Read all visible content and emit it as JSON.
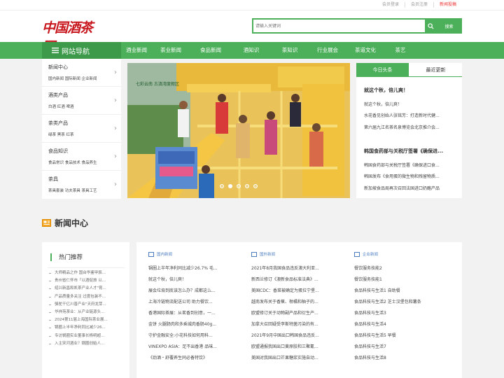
{
  "topbar": {
    "links": [
      "会员登录",
      "会员注册",
      "新闻投稿"
    ]
  },
  "logo": {
    "text": "中国酒茶网"
  },
  "search": {
    "placeholder": "请输入关键词",
    "button": "搜索"
  },
  "nav": {
    "title": "网站导航",
    "items": [
      "酒业新闻",
      "茶业新闻",
      "食品新闻",
      "酒知识",
      "茶知识",
      "行业展会",
      "茶道文化",
      "茶艺"
    ]
  },
  "sidebar": [
    {
      "title": "新闻中心",
      "sub": "国内新闻 国际新闻 企业新闻"
    },
    {
      "title": "酒类产品",
      "sub": "白酒 红酒 啤酒"
    },
    {
      "title": "茶类产品",
      "sub": "绿茶 黑茶 红茶"
    },
    {
      "title": "食品知识",
      "sub": "食品常识 食品技术 食品养生"
    },
    {
      "title": "茶具",
      "sub": "茶具套装 功夫茶具 茶具工艺"
    }
  ],
  "banner": {
    "caption": "七彩云南 古滇湾度假区"
  },
  "right_panel": {
    "tabs": [
      "今日头条",
      "最近更新"
    ],
    "headlines": [
      "就这个秋，倍儿爽！",
      "韩国食药部与关税厅签署《确保进..."
    ],
    "group1": [
      "就这个秋，倍儿爽！",
      "水花香见创始人张铭芳：打造新时代健...",
      "第六届九江名茶名泉博览会北京推介会..."
    ],
    "group2": [
      "韩国食药部与关税厅签署《确保进口食...",
      "韩国发布《食用蛋的微生物和残留物质...",
      "新加坡食品局再次召回法国进口奶酪产品"
    ]
  },
  "news_center": {
    "title": "新闻中心"
  },
  "hot": {
    "title": "热门推荐",
    "items": [
      "大师精品之作 国台华鉴甲辰...",
      "贵州省仁怀市「以酒促旅 以...",
      "绍兴新昌和凯茶产业人才\"育...",
      "产品质量多关注 过度包装不...",
      "骆驼干亿川普产业\"天府龙芽...",
      "华祥苑茶业：从产业链源头...",
      "2024第11届上海国际茶业展...",
      "锅圈上半年净利同比减少26...",
      "专访锅圈实业董事长杨明超...",
      "入主宋河酒业？锅圈创始人..."
    ]
  },
  "columns": [
    {
      "head": "国内新闻",
      "items": [
        "锅圈上半年净利同比减少26.7% 毛...",
        "就这个秋，倍儿爽！",
        "展会垃圾到底该怎么办？成都这么...",
        "上海冷链物流配送公司 助力餐饮...",
        "香港国际茶展：从茗香到创意，一...",
        "金饼 火腿肠肉和多乘城肉香肠40g...",
        "守护金融安全:小花科技如何用科...",
        "VINEXPO ASIA：足不出香港 品味...",
        "《劲酒・舒覆养生同必备特饮》"
      ]
    },
    {
      "head": "国外新闻",
      "items": [
        "2021年8月我国食品违反澳大利亚...",
        "新西兰修订《澳新食品标准法典》...",
        "美国CDC：香菜被确定为蛋拉宁堡...",
        "越南发布关于香蕉、柑橘和柚子的...",
        "欧盟修订关于动物副产品和衍生产...",
        "加拿大召回疑受李斯特菌污染的有...",
        "2021年9月中国出口韩国食品违反...",
        "欧盟通报我国出口黄原胶和三聚氰...",
        "美国对我国出口芒果糖浆实施自动..."
      ]
    },
    {
      "head": "企业新闻",
      "items": [
        "餐饮服务技能2",
        "餐饮服务技能1",
        "食品科技与生活1 自助餐",
        "食品科技与生活2 芝士汉堡包和薯条",
        "食品科技与生活3",
        "食品科技与生活4",
        "食品科技与生活5 早餐",
        "食品科技与生活7",
        "食品科技与生活8"
      ]
    }
  ],
  "colors": {
    "green": "#4cb05b",
    "dark_green": "#3c9a4a",
    "red": "#c8161d",
    "link_blue": "#4a7cc0"
  }
}
